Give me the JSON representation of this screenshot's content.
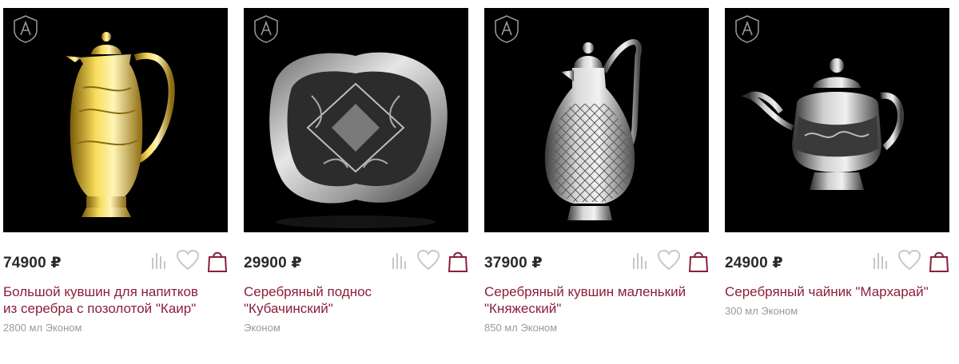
{
  "products": [
    {
      "price": "74900 ₽",
      "title_line1": "Большой кувшин для напитков",
      "title_line2": "из серебра с позолотой \"Каир\"",
      "subtitle": "2800 мл Эконом",
      "image": "gold-pitcher"
    },
    {
      "price": "29900 ₽",
      "title_line1": "Серебряный поднос",
      "title_line2": "\"Кубачинский\"",
      "subtitle": "Эконом",
      "image": "silver-tray"
    },
    {
      "price": "37900 ₽",
      "title_line1": "Серебряный кувшин маленький",
      "title_line2": "\"Княжеский\"",
      "subtitle": "850 мл Эконом",
      "image": "silver-jug"
    },
    {
      "price": "24900 ₽",
      "title_line1": "Серебряный чайник \"Мархарай\"",
      "title_line2": "",
      "subtitle": "300 мл Эконом",
      "image": "silver-teapot"
    }
  ],
  "icons": {
    "compare": "compare-icon",
    "favorite": "heart-icon",
    "cart": "shopping-bag-icon"
  },
  "colors": {
    "title": "#8a1f3a",
    "price": "#2a2a2a",
    "subtitle": "#9a9a9a",
    "icon": "#c7c7c7",
    "cart_icon": "#8a1f3a"
  }
}
